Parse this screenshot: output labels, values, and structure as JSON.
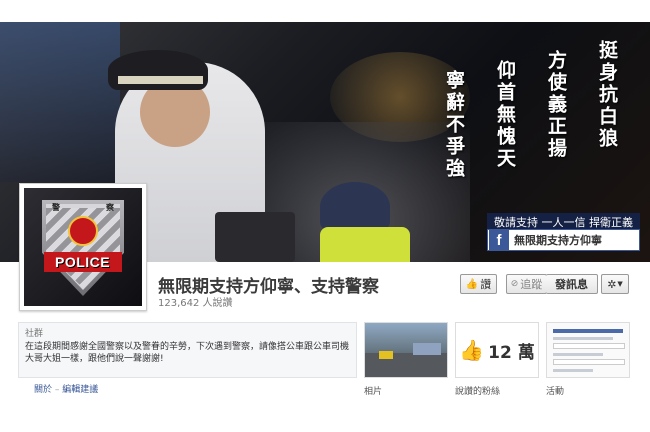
{
  "cover": {
    "slogans": [
      "挺身抗白狼",
      "方使義正揚",
      "仰首無愧天",
      "寧辭不爭強"
    ],
    "support_line": "敬請支持 一人一信 捍衛正義",
    "fb_pill_label": "無限期支持方仰寧",
    "colors": {
      "fb_blue": "#3b5998"
    }
  },
  "profile": {
    "badge_chars": [
      "警",
      "察"
    ],
    "police_label": "POLICE"
  },
  "page": {
    "name": "無限期支持方仰寧、支持警察",
    "likes_text": "123,642 人說讚"
  },
  "actions": {
    "like": "讚",
    "follow": "追蹤",
    "message": "發訊息",
    "settings_icon": "gear-icon"
  },
  "about": {
    "category": "社群",
    "description": "在這段期間感謝全國警察以及警眷的辛勞，下次遇到警察，請像搭公車跟公車司機大哥大姐一樣，跟他們說一聲謝謝!",
    "about_link": "關於",
    "separator": " – ",
    "edit_link": "編輯建議"
  },
  "apps": {
    "photos_label": "相片",
    "likes_label": "說讚的粉絲",
    "likes_value": "12 萬",
    "events_label": "活動"
  }
}
